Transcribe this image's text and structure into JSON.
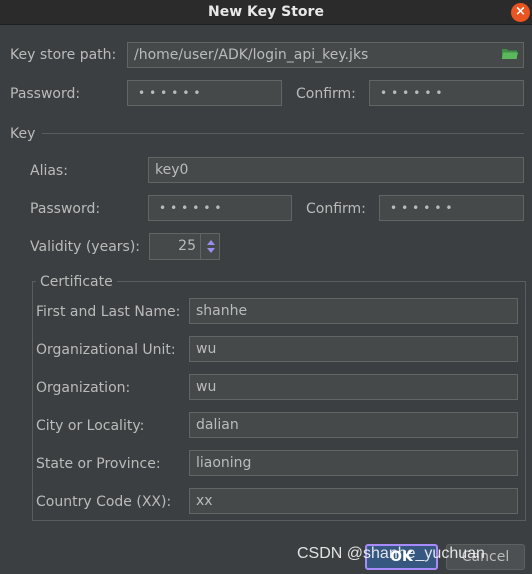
{
  "window": {
    "title": "New Key Store",
    "close_symbol": "×"
  },
  "keystore": {
    "path_label": "Key store path:",
    "path_value": "/home/user/ADK/login_api_key.jks",
    "password_label": "Password:",
    "password_value": "••••••",
    "confirm_label": "Confirm:",
    "confirm_value": "••••••"
  },
  "key": {
    "section_label": "Key",
    "alias_label": "Alias:",
    "alias_value": "key0",
    "password_label": "Password:",
    "password_value": "••••••",
    "confirm_label": "Confirm:",
    "confirm_value": "••••••",
    "validity_label": "Validity (years):",
    "validity_value": "25"
  },
  "certificate": {
    "section_label": "Certificate",
    "name_label": "First and Last Name:",
    "name_value": "shanhe",
    "unit_label": "Organizational Unit:",
    "unit_value": "wu",
    "org_label": "Organization:",
    "org_value": "wu",
    "city_label": "City or Locality:",
    "city_value": "dalian",
    "state_label": "State or Province:",
    "state_value": "liaoning",
    "country_label": "Country Code (XX):",
    "country_value": "xx"
  },
  "footer": {
    "ok_label": "OK",
    "cancel_label": "Cancel",
    "watermark": "CSDN @shanhe_yuchuan"
  },
  "colors": {
    "background": "#3c3f41",
    "field_background": "#45494a",
    "ok_border": "#a78bfa",
    "close_button": "#e95420",
    "folder_icon": "#4caf50"
  },
  "icons": {
    "close": "close-icon",
    "folder": "folder-icon",
    "spinner_up": "chevron-up-icon",
    "spinner_down": "chevron-down-icon"
  }
}
